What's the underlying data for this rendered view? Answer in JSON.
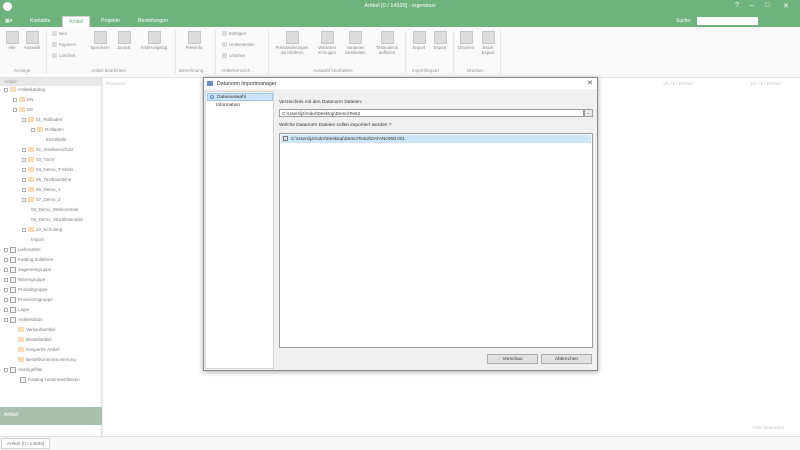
{
  "window": {
    "title": "Artikel [0 / 14530] - ingenious"
  },
  "menubar": {
    "app_menu": "▦▾",
    "tabs": [
      "Kontakte",
      "Artikel",
      "Projekte",
      "Bestellungen"
    ],
    "active_tab": "Artikel",
    "search_label": "Suche:",
    "search_value": ""
  },
  "ribbon": {
    "anzeige": {
      "label": "Anzeige",
      "buttons": [
        "Alle",
        "Auswahl"
      ]
    },
    "bearbeiten": {
      "label": "Artikel bearbeiten",
      "small": [
        "Neu",
        "Kopieren",
        "Löschen"
      ],
      "buttons": [
        "Speichern",
        "Zurück",
        "Änderungslog"
      ]
    },
    "berechnung": {
      "label": "Berechnung...",
      "buttons": [
        "Preisinfo"
      ]
    },
    "verzeichnis": {
      "label": "Artikelverzeich...",
      "small": [
        "Einfügen",
        "Umbenennen",
        "Löschen"
      ]
    },
    "auswahl": {
      "label": "Auswahl bearbeiten",
      "buttons": [
        "Preisänderungen durchführen",
        "Varianten erzeugen",
        "Varianten bearbeiten",
        "Textmakros auflösen"
      ]
    },
    "importexport": {
      "label": "Import/Export",
      "buttons": [
        "Import",
        "Export"
      ]
    },
    "drucken": {
      "label": "Drucken",
      "buttons": [
        "Drucken",
        "Excel Export"
      ]
    }
  },
  "leftpane": {
    "header": "Artikel",
    "tree": [
      "Artikelkatalog",
      "EN",
      "DE",
      "01_Rollladen",
      "Rollladen",
      "Einzelteile",
      "02_Insektenschutz",
      "03_Tisch",
      "04_Demo_T-Shirts",
      "05_Textbausteine",
      "06_Demo_1",
      "07_Demo_2",
      "08_Demo_Webcentrale",
      "09_Demo_Stücklistenteile",
      "10_Schulung",
      "Import",
      "Lieferanten",
      "Katalog Zulieferer",
      "Sagemengruppe",
      "Warengruppe",
      "Produktgruppe",
      "Provisionsgruppe",
      "Lager",
      "Artikelstatus",
      "Verkaufsartikel",
      "Bestellartikel",
      "Gesperrte Artikel",
      "Bestellkommissionierung",
      "Anzeigefilter",
      "Katalog zusammenfassen"
    ],
    "bottom": "Artikel"
  },
  "main": {
    "columns": [
      "Preistexte",
      "VK / € / Einheit",
      "EK / € / Einheit"
    ],
    "filter_label": "Filter bearbeiten"
  },
  "statusbar": {
    "tab": "Artikel [0 / 14530]"
  },
  "dialog": {
    "title": "Datanorm Importmanager",
    "nav": [
      "Dateiauswahl",
      "Information"
    ],
    "dir_label": "Verzeichnis mit den Datanorm Dateien:",
    "dir_value": "C:\\Users\\jzirndor\\Desktop\\Demo\\Test2",
    "browse": "...",
    "files_label": "Welche Datanorm Dateien sollen importiert werden ?",
    "files": [
      {
        "checked": "✓",
        "name": "C:\\Users\\jzirndor\\Desktop\\Demo\\Test2\\DATANORM.001"
      }
    ],
    "buttons": {
      "preview": "Vorschau",
      "cancel": "Abbrechen"
    }
  }
}
